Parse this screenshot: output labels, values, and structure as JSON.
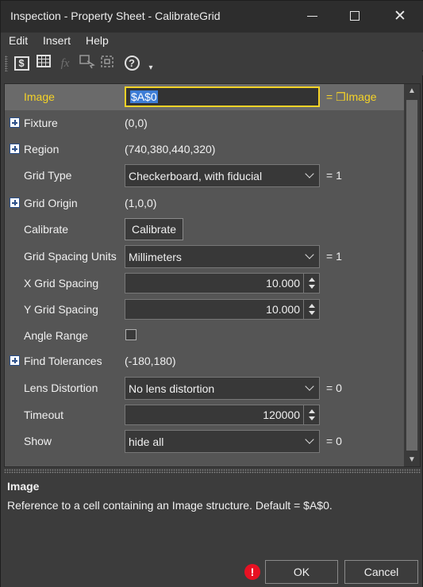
{
  "window": {
    "title": "Inspection - Property Sheet - CalibrateGrid",
    "controls": {
      "minimize": "minimize-icon",
      "maximize": "maximize-icon",
      "close": "✕"
    }
  },
  "menu": [
    "Edit",
    "Insert",
    "Help"
  ],
  "toolbar": {
    "icons": [
      "cell-reference-icon",
      "spreadsheet-icon",
      "function-icon",
      "select-region-icon",
      "select-all-icon",
      "help-icon",
      "overflow-icon"
    ],
    "cell_glyph": "$",
    "fx_glyph": "fx",
    "help_glyph": "?",
    "more_glyph": "▾"
  },
  "properties": {
    "image": {
      "label": "Image",
      "value": "$A$0",
      "suffix": "= ❒Image"
    },
    "fixture": {
      "label": "Fixture",
      "value": "(0,0)"
    },
    "region": {
      "label": "Region",
      "value": "(740,380,440,320)"
    },
    "grid_type": {
      "label": "Grid Type",
      "value": "Checkerboard, with fiducial",
      "suffix": "= 1"
    },
    "grid_origin": {
      "label": "Grid Origin",
      "value": "(1,0,0)"
    },
    "calibrate": {
      "label": "Calibrate",
      "button": "Calibrate"
    },
    "grid_spacing_units": {
      "label": "Grid Spacing Units",
      "value": "Millimeters",
      "suffix": "= 1"
    },
    "x_grid_spacing": {
      "label": "X Grid Spacing",
      "value": "10.000"
    },
    "y_grid_spacing": {
      "label": "Y Grid Spacing",
      "value": "10.000"
    },
    "angle_range": {
      "label": "Angle Range",
      "checked": false
    },
    "find_tolerances": {
      "label": "Find Tolerances",
      "value": "(-180,180)"
    },
    "lens_distortion": {
      "label": "Lens Distortion",
      "value": "No lens distortion",
      "suffix": "= 0"
    },
    "timeout": {
      "label": "Timeout",
      "value": "120000"
    },
    "show": {
      "label": "Show",
      "value": "hide all",
      "suffix": "= 0"
    }
  },
  "description": {
    "title": "Image",
    "text": "Reference to a cell containing an Image structure. Default = $A$0."
  },
  "footer": {
    "warning_glyph": "!",
    "ok": "OK",
    "cancel": "Cancel"
  },
  "colors": {
    "selected_label": "#f5d327",
    "selection_highlight": "#3d7dd6",
    "warning": "#e81123"
  }
}
